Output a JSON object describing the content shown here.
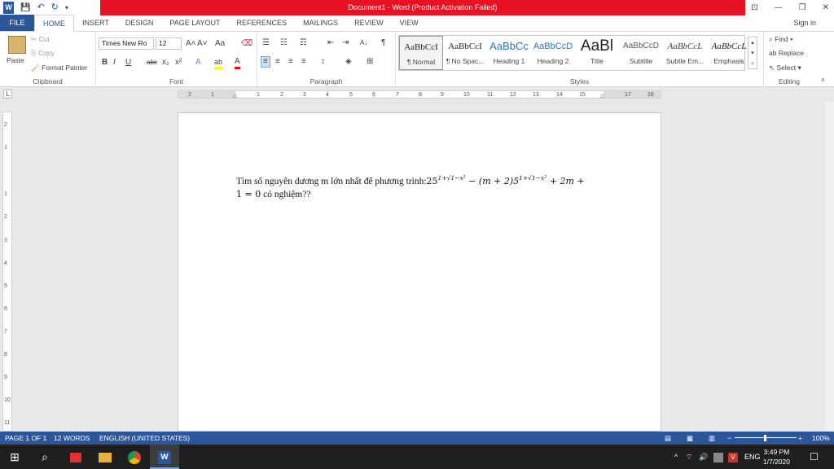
{
  "window": {
    "title": "Document1 - Word (Product Activation Failed)",
    "help": "?",
    "ribbon_display": "⊡",
    "minimize": "—",
    "restore": "❐",
    "close": "✕"
  },
  "qat": {
    "app_icon": "W",
    "save": "💾",
    "undo": "↶",
    "redo": "↻",
    "customize": "▾"
  },
  "tabs": [
    "FILE",
    "HOME",
    "INSERT",
    "DESIGN",
    "PAGE LAYOUT",
    "REFERENCES",
    "MAILINGS",
    "REVIEW",
    "VIEW"
  ],
  "signin": "Sign in",
  "clipboard": {
    "paste": "Paste",
    "cut": "Cut",
    "copy": "Copy",
    "format_painter": "Format Painter",
    "label": "Clipboard"
  },
  "font": {
    "name": "Times New Ro",
    "size": "12",
    "grow": "A˄",
    "shrink": "A˅",
    "case": "Aa",
    "clear": "⌫",
    "bold": "B",
    "italic": "I",
    "underline": "U",
    "strike": "abc",
    "sub": "x₂",
    "sup": "x²",
    "effects": "A",
    "highlight": "ab",
    "color": "A",
    "label": "Font"
  },
  "paragraph": {
    "bullets": "☰",
    "numbering": "☷",
    "multilevel": "☶",
    "dec_indent": "⇤",
    "inc_indent": "⇥",
    "sort": "A↓",
    "marks": "¶",
    "left": "≡",
    "center": "≡",
    "right": "≡",
    "justify": "≡",
    "spacing": "↕",
    "shading": "◈",
    "borders": "⊞",
    "label": "Paragraph"
  },
  "styles": {
    "items": [
      {
        "preview": "AaBbCcI",
        "name": "¶ Normal"
      },
      {
        "preview": "AaBbCcI",
        "name": "¶ No Spac..."
      },
      {
        "preview": "AaBbCc",
        "name": "Heading 1"
      },
      {
        "preview": "AaBbCcD",
        "name": "Heading 2"
      },
      {
        "preview": "AaBl",
        "name": "Title"
      },
      {
        "preview": "AaBbCcD",
        "name": "Subtitle"
      },
      {
        "preview": "AaBbCcL",
        "name": "Subtle Em..."
      },
      {
        "preview": "AaBbCcL",
        "name": "Emphasis"
      }
    ],
    "label": "Styles"
  },
  "editing": {
    "find": "Find",
    "replace": "Replace",
    "select": "Select",
    "label": "Editing"
  },
  "ruler": {
    "tab_marker": "L",
    "h_numbers": [
      "2",
      "1",
      "1",
      "2",
      "3",
      "4",
      "5",
      "6",
      "7",
      "8",
      "9",
      "10",
      "11",
      "12",
      "13",
      "14",
      "15",
      "17",
      "18"
    ],
    "v_numbers": [
      "2",
      "1",
      "1",
      "2",
      "3",
      "4",
      "5",
      "6",
      "7",
      "8",
      "9",
      "10",
      "11"
    ]
  },
  "document": {
    "line1_text": "Tìm số nguyên dương m lớn nhất để phương trình:",
    "eq_base1": "25",
    "eq_exp1": "1+√1−x²",
    "eq_mid": " − (m + 2)5",
    "eq_exp2": "1+√1−x²",
    "eq_end1": " + 2m +",
    "eq_line2": "1 = 0",
    "line2_text": " có nghiệm??"
  },
  "status": {
    "page": "PAGE 1 OF 1",
    "words": "12 WORDS",
    "language": "ENGLISH (UNITED STATES)",
    "zoom": "100%",
    "zoom_minus": "−",
    "zoom_plus": "+"
  },
  "taskbar": {
    "start": "⊞",
    "search": "⌕",
    "time": "3:49 PM",
    "date": "1/7/2020",
    "lang": "ENG",
    "notifications": "☐",
    "volume": "🔊",
    "wifi": "⌔",
    "chevron": "^"
  }
}
